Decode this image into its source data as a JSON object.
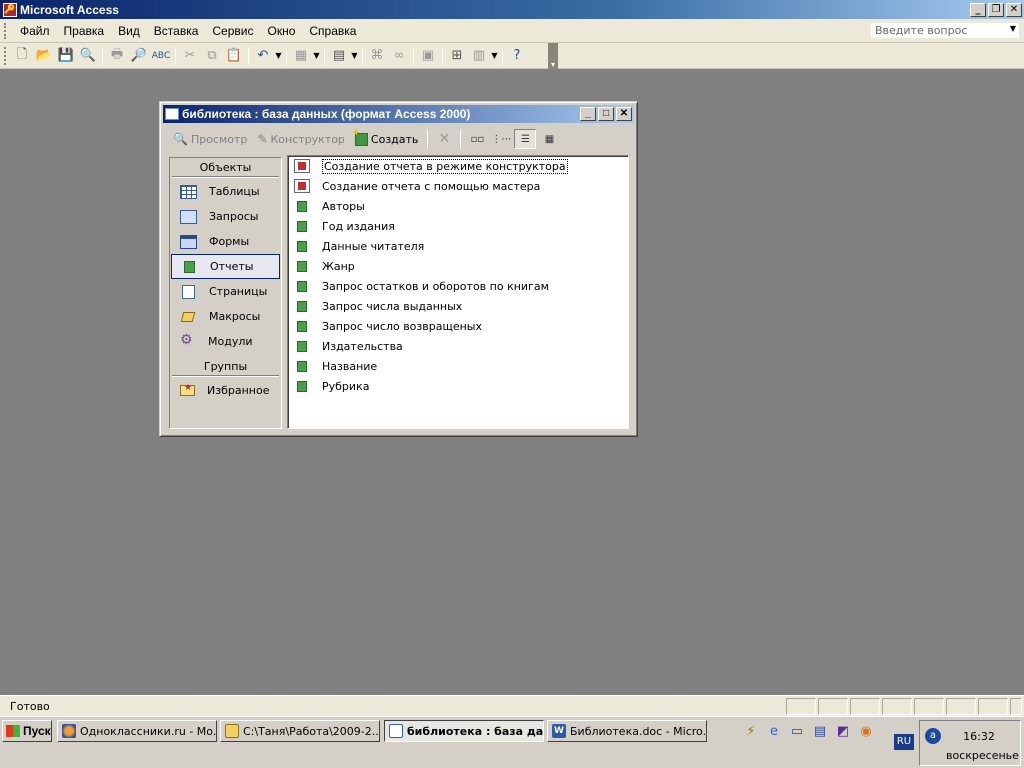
{
  "app": {
    "title": "Microsoft Access",
    "icon": "access-app-icon"
  },
  "window_controls": {
    "minimize": "_",
    "restore": "❐",
    "close": "✕"
  },
  "menu": {
    "items": [
      "Файл",
      "Правка",
      "Вид",
      "Вставка",
      "Сервис",
      "Окно",
      "Справка"
    ],
    "help_placeholder": "Введите вопрос"
  },
  "db_window": {
    "title": "библиотека : база данных (формат Access 2000)",
    "toolbar": {
      "preview": "Просмотр",
      "design": "Конструктор",
      "create": "Создать"
    },
    "objects_header": "Объекты",
    "objects": [
      "Таблицы",
      "Запросы",
      "Формы",
      "Отчеты",
      "Страницы",
      "Макросы",
      "Модули"
    ],
    "selected_object": "Отчеты",
    "groups_header": "Группы",
    "groups": [
      "Избранное"
    ],
    "list_items": [
      {
        "label": "Создание отчета в режиме конструктора",
        "icon": "design-wizard-icon"
      },
      {
        "label": "Создание отчета с помощью мастера",
        "icon": "report-wizard-icon"
      },
      {
        "label": "Авторы",
        "icon": "report-icon"
      },
      {
        "label": "Год издания",
        "icon": "report-icon"
      },
      {
        "label": "Данные читателя",
        "icon": "report-icon"
      },
      {
        "label": "Жанр",
        "icon": "report-icon"
      },
      {
        "label": "Запрос остатков и оборотов по книгам",
        "icon": "report-icon"
      },
      {
        "label": "Запрос числа выданных",
        "icon": "report-icon"
      },
      {
        "label": "Запрос число возвращеных",
        "icon": "report-icon"
      },
      {
        "label": "Издательства",
        "icon": "report-icon"
      },
      {
        "label": "Название",
        "icon": "report-icon"
      },
      {
        "label": "Рубрика",
        "icon": "report-icon"
      }
    ]
  },
  "status": {
    "text": "Готово"
  },
  "taskbar": {
    "start": "Пуск",
    "tasks": [
      {
        "label": "Одноклассники.ru - Мо..."
      },
      {
        "label": "C:\\Таня\\Работа\\2009-2..."
      },
      {
        "label": "библиотека : база да..."
      },
      {
        "label": "Библиотека.doc - Micro..."
      }
    ],
    "lang": "RU",
    "clock": "16:32",
    "day": "воскресенье"
  },
  "colors": {
    "title_active": "#0a246a",
    "desktop_bg": "#808080",
    "report_icon": "#4aa04a"
  }
}
